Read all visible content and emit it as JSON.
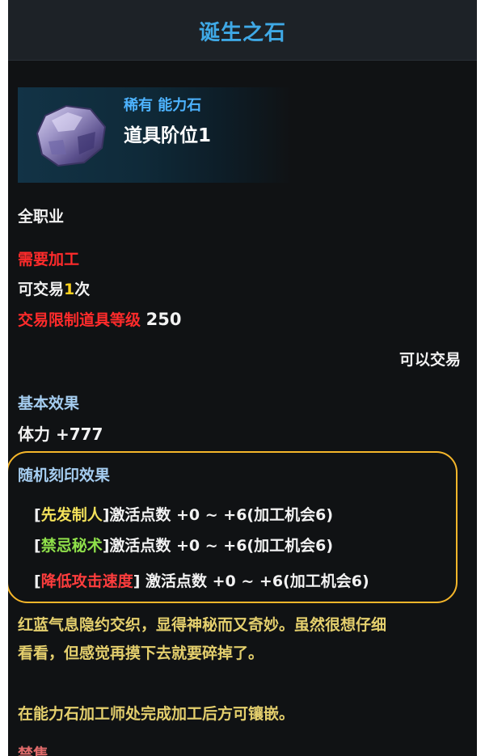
{
  "item": {
    "name": "诞生之石",
    "rarity_type": "稀有 能力石",
    "tier": "道具阶位1"
  },
  "job_restriction": "全职业",
  "processing": {
    "required": "需要加工",
    "trade_prefix": "可交易",
    "trade_count": "1",
    "trade_suffix": "次",
    "level_label": "交易限制道具等级",
    "level_value": "250",
    "tradable": "可以交易"
  },
  "basic_effect": {
    "label": "基本效果",
    "stat": "体力 +777"
  },
  "random_engrave": {
    "label": "随机刻印效果",
    "entries": [
      {
        "open": "[",
        "name": "先发制人",
        "close": "]",
        "text": "激活点数 +0 ~ +6(加工机会6)"
      },
      {
        "open": "[",
        "name": "禁忌秘术",
        "close": "]",
        "text": "激活点数 +0 ~ +6(加工机会6)"
      },
      {
        "open": "[",
        "name": "降低攻击速度",
        "close": "]",
        "text": " 激活点数 +0 ~ +6(加工机会6)"
      }
    ]
  },
  "description": {
    "line1": "红蓝气息隐约交织，显得神秘而又奇妙。虽然很想仔细",
    "line2": "看看，但感觉再摸下去就要碎掉了。"
  },
  "instruction": "在能力石加工师处完成加工后方可镶嵌。",
  "footer_partial": "禁售",
  "colors": {
    "title": "#3fa9e6",
    "rarity": "#4db3ff",
    "warning": "#ff2b2b",
    "highlight_box": "#f5b62a",
    "description": "#e4cf6d"
  },
  "icons": [
    "ability-stone-icon"
  ]
}
